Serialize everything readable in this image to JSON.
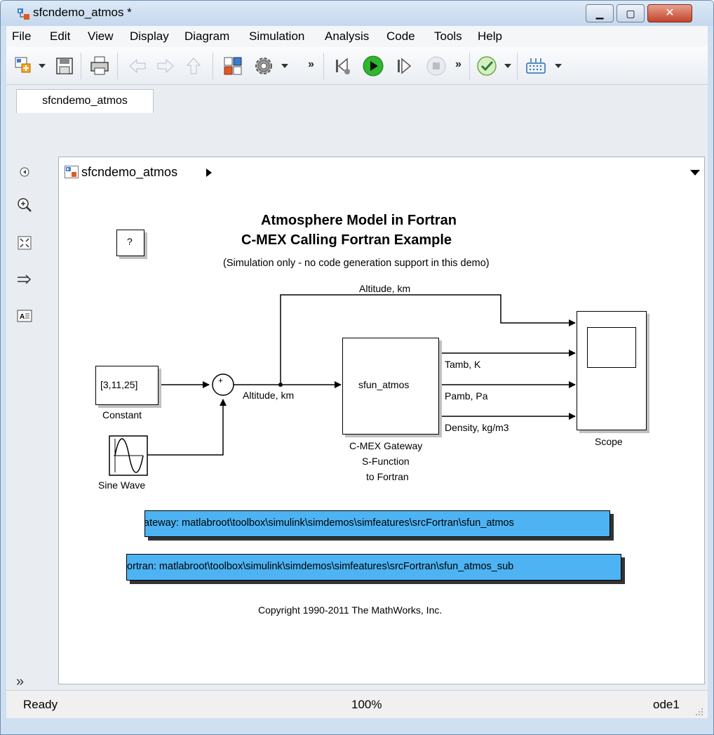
{
  "window": {
    "title": "sfcndemo_atmos *"
  },
  "menubar": {
    "items": [
      "File",
      "Edit",
      "View",
      "Display",
      "Diagram",
      "Simulation",
      "Analysis",
      "Code",
      "Tools",
      "Help"
    ]
  },
  "toolbar": {
    "icons": [
      "new-model-icon",
      "save-icon",
      "print-icon",
      "back-icon",
      "forward-icon",
      "up-icon",
      "library-browser-icon",
      "settings-gear-icon",
      "step-back-icon",
      "run-icon",
      "step-forward-icon",
      "stop-icon",
      "check-icon",
      "keyboard-icon"
    ]
  },
  "tab": {
    "label": "sfcndemo_atmos"
  },
  "addressbar": {
    "path": "sfcndemo_atmos"
  },
  "diagram": {
    "title_line1": "Atmosphere Model in Fortran",
    "title_line2": "C-MEX Calling Fortran Example",
    "subtitle": "(Simulation only - no code generation support in this demo)",
    "help_block": "?",
    "top_signal_label": "Altitude, km",
    "constant_value": "[3,11,25]",
    "constant_label": "Constant",
    "sine_label": "Sine Wave",
    "sum_signs": "+",
    "altitude_label": "Altitude, km",
    "sfun_name": "sfun_atmos",
    "sfun_caption_1": "C-MEX Gateway",
    "sfun_caption_2": "S-Function",
    "sfun_caption_3": "to Fortran",
    "out1_label": "Tamb, K",
    "out2_label": "Pamb, Pa",
    "out3_label": "Density, kg/m3",
    "scope_label": "Scope",
    "note1": "ateway: matlabroot\\toolbox\\simulink\\simdemos\\simfeatures\\srcFortran\\sfun_atmos",
    "note2": "ortran: matlabroot\\toolbox\\simulink\\simdemos\\simfeatures\\srcFortran\\sfun_atmos_sub",
    "copyright": "Copyright 1990-2011 The MathWorks, Inc."
  },
  "statusbar": {
    "status": "Ready",
    "zoom": "100%",
    "solver": "ode1"
  },
  "colors": {
    "note_fill": "#4db3f3",
    "run_green": "#2fb52f"
  }
}
